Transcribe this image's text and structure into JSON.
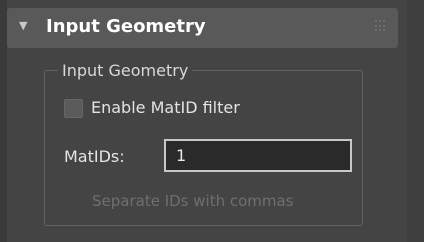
{
  "rollout": {
    "title": "Input Geometry",
    "expanded": true,
    "expand_icon": "triangle-down-icon",
    "grip_icon": "grip-dots-icon"
  },
  "group": {
    "title": "Input Geometry",
    "enable_matid_filter": {
      "label": "Enable MatID filter",
      "checked": false
    },
    "matids": {
      "label": "MatIDs:",
      "value": "1"
    },
    "hint": "Separate IDs with commas"
  },
  "colors": {
    "panel_background": "#444444",
    "header_background": "#595959",
    "input_background": "#2a2a2a",
    "input_border": "#c9c9c9",
    "hint_text": "#6f6f6f"
  }
}
